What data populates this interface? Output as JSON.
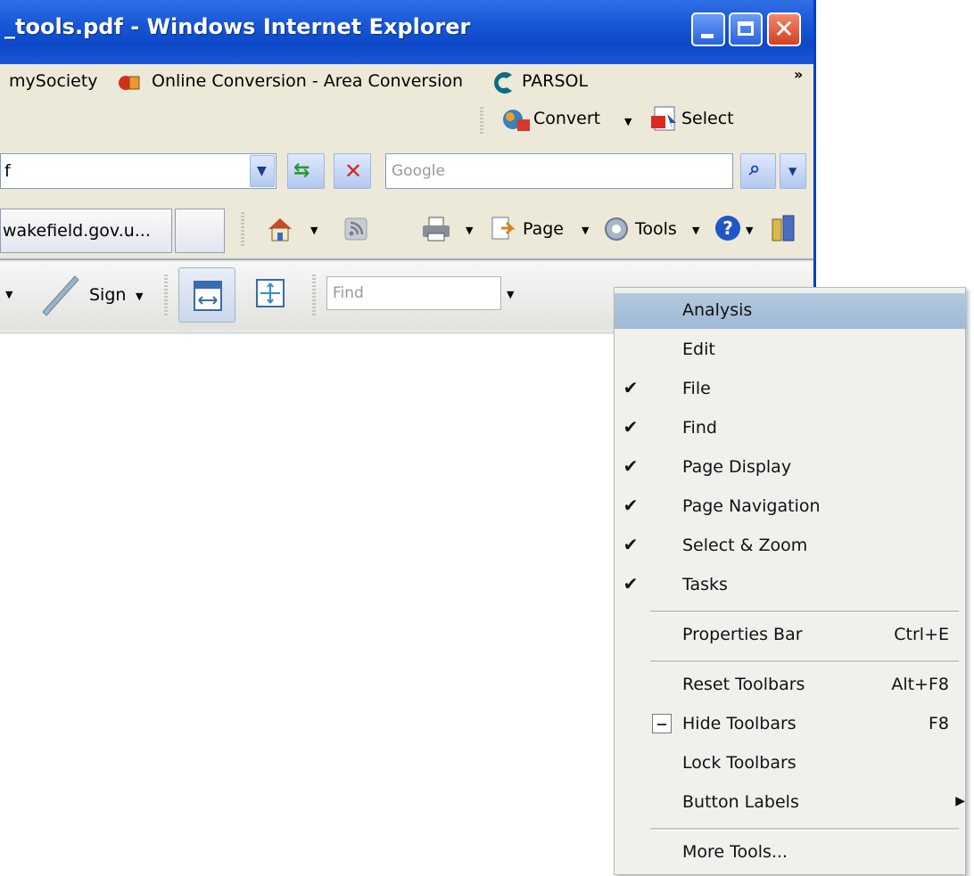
{
  "window": {
    "title": "_tools.pdf - Windows Internet Explorer",
    "controls": {
      "minimize": "_",
      "maximize": "□",
      "close": "✕"
    }
  },
  "links_bar": {
    "items": [
      {
        "label": "mySociety",
        "icon": "none"
      },
      {
        "label": "Online Conversion - Area Conversion",
        "icon": "online-conversion-icon"
      },
      {
        "label": "PARSOL",
        "icon": "parsol-icon"
      }
    ],
    "chevron": "»",
    "convert_label": "Convert",
    "select_label": "Select"
  },
  "address_bar": {
    "url_fragment": "f",
    "search_placeholder": "Google"
  },
  "command_bar": {
    "tab_label": "wakefield.gov.u...",
    "page_label": "Page",
    "tools_label": "Tools"
  },
  "acrobat_toolbar": {
    "sign_label": "Sign",
    "find_placeholder": "Find"
  },
  "context_menu": {
    "items": [
      {
        "label": "Analysis",
        "checked": false,
        "highlighted": true
      },
      {
        "label": "Edit",
        "checked": false
      },
      {
        "label": "File",
        "checked": true
      },
      {
        "label": "Find",
        "checked": true
      },
      {
        "label": "Page Display",
        "checked": true
      },
      {
        "label": "Page Navigation",
        "checked": true
      },
      {
        "label": "Select & Zoom",
        "checked": true
      },
      {
        "label": "Tasks",
        "checked": true
      }
    ],
    "properties_bar": {
      "label": "Properties Bar",
      "shortcut": "Ctrl+E"
    },
    "reset_toolbars": {
      "label": "Reset Toolbars",
      "shortcut": "Alt+F8"
    },
    "hide_toolbars": {
      "label": "Hide Toolbars",
      "shortcut": "F8"
    },
    "lock_toolbars": {
      "label": "Lock Toolbars"
    },
    "button_labels": {
      "label": "Button Labels",
      "submenu_arrow": "▶"
    },
    "more_tools": {
      "label": "More Tools..."
    },
    "check_glyph": "✔"
  }
}
